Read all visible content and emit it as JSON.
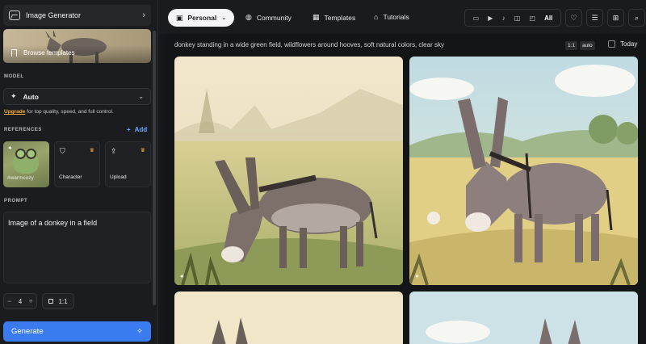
{
  "sidebar": {
    "header_title": "Image Generator",
    "browse_label": "Browse templates",
    "model_label": "MODEL",
    "model_value": "Auto",
    "upgrade_link": "Upgrade",
    "upgrade_text": " for top quality, speed, and full control.",
    "references_label": "REFERENCES",
    "add_label": "Add",
    "references": [
      {
        "label": "#warmcozy"
      },
      {
        "label": "Character"
      },
      {
        "label": "Upload"
      }
    ],
    "prompt_label": "PROMPT",
    "prompt_text": "Image of a donkey in a field",
    "count_value": "4",
    "ratio_value": "1:1",
    "generate_label": "Generate"
  },
  "topnav": {
    "tabs": [
      {
        "label": "Personal"
      },
      {
        "label": "Community"
      },
      {
        "label": "Templates"
      },
      {
        "label": "Tutorials"
      }
    ],
    "filter_all": "All"
  },
  "main": {
    "prompt_text": "donkey standing in a wide green field, wildflowers around hooves, soft natural colors, clear sky",
    "chip_ratio": "1:1",
    "chip_mode": "auto",
    "today_label": "Today"
  },
  "colors": {
    "accent": "#3b7bf0",
    "link": "#6ea8ff",
    "premium": "#f2a93b"
  }
}
